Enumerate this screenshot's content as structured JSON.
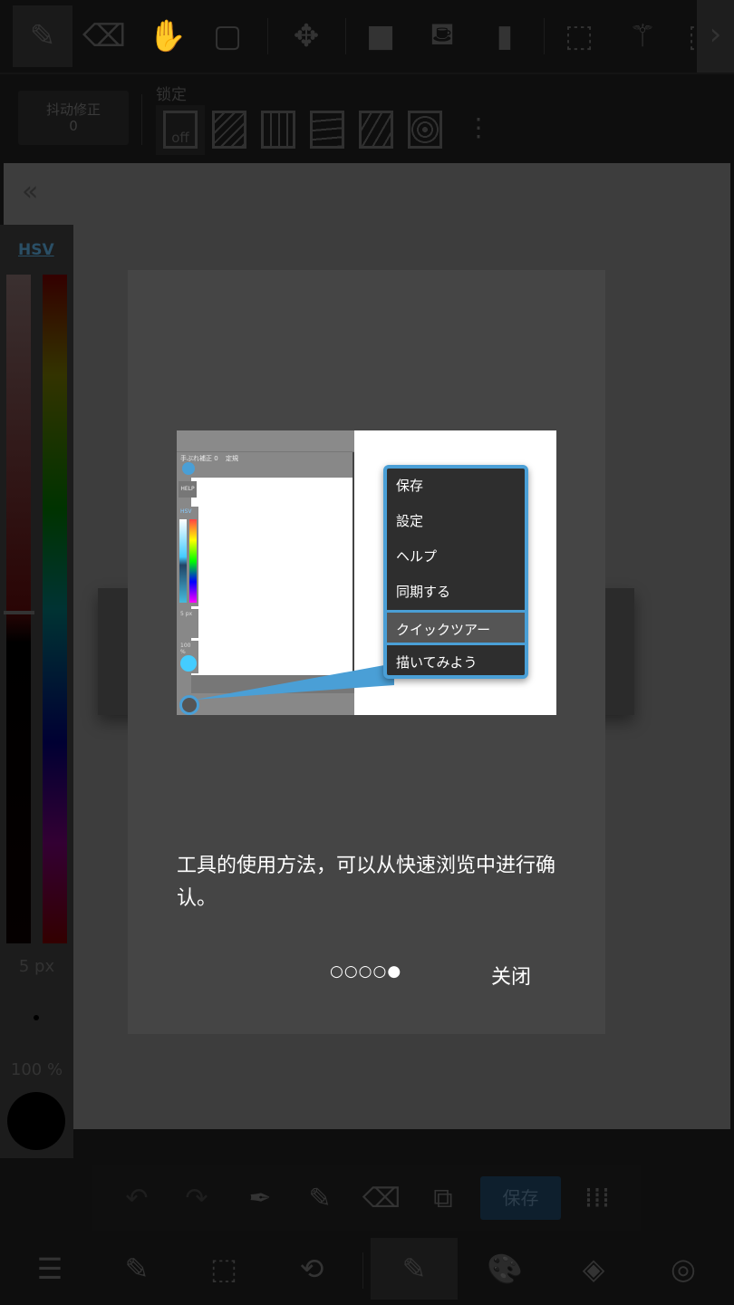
{
  "toolbar": {
    "tools": [
      {
        "icon": "pen-icon",
        "glyph": "✎",
        "selected": true
      },
      {
        "icon": "eraser-icon",
        "glyph": "⌫"
      },
      {
        "icon": "hand-icon",
        "glyph": "✋"
      },
      {
        "icon": "rectangle-icon",
        "glyph": "▢"
      },
      {
        "icon": "move-icon",
        "glyph": "✥"
      },
      {
        "icon": "fill-rect-icon",
        "glyph": "■"
      },
      {
        "icon": "bucket-icon",
        "glyph": "⛾"
      },
      {
        "icon": "gradient-icon",
        "glyph": "▮"
      },
      {
        "icon": "select-rect-icon",
        "glyph": "⬚"
      },
      {
        "icon": "magic-wand-icon",
        "glyph": "⚚"
      },
      {
        "icon": "select-pen-icon",
        "glyph": "⬚"
      }
    ],
    "next_glyph": "›"
  },
  "stabilizer": {
    "label": "抖动修正",
    "value": "0"
  },
  "snap": {
    "label": "锁定",
    "off_label": "off",
    "more_glyph": "⋮"
  },
  "canvas": {
    "back_glyph": "«"
  },
  "color_panel": {
    "mode": "HSV",
    "brush_size": "5 px",
    "opacity": "100 %",
    "color": "#000000"
  },
  "dialog": {
    "text": "工具的使用方法，可以从快速浏览中进行确认。",
    "pages": "○○○○●",
    "page_current": 5,
    "page_total": 5,
    "close_label": "关闭",
    "illustration": {
      "mini_stabilizer": "手ぶれ補正 0",
      "mini_snap": "定規",
      "help": "HELP",
      "hsv": "HSV",
      "size": "5 px",
      "opacity": "100 %",
      "menu": [
        "保存",
        "設定",
        "ヘルプ",
        "同期する",
        "クイックツアー",
        "描いてみよう"
      ],
      "highlight_index": 4,
      "accent": "#4a9fd6"
    }
  },
  "subbar": {
    "save_label": "保存"
  },
  "bottombar": [
    {
      "icon": "menu-icon",
      "glyph": "☰"
    },
    {
      "icon": "edit-icon",
      "glyph": "✎"
    },
    {
      "icon": "selection-icon",
      "glyph": "⬚"
    },
    {
      "icon": "rotate-icon",
      "glyph": "⟲"
    },
    {
      "icon": "pen-icon",
      "glyph": "✎",
      "selected": true
    },
    {
      "icon": "palette-icon",
      "glyph": "🎨"
    },
    {
      "icon": "layers-icon",
      "glyph": "◈"
    },
    {
      "icon": "material-icon",
      "glyph": "◎"
    }
  ]
}
